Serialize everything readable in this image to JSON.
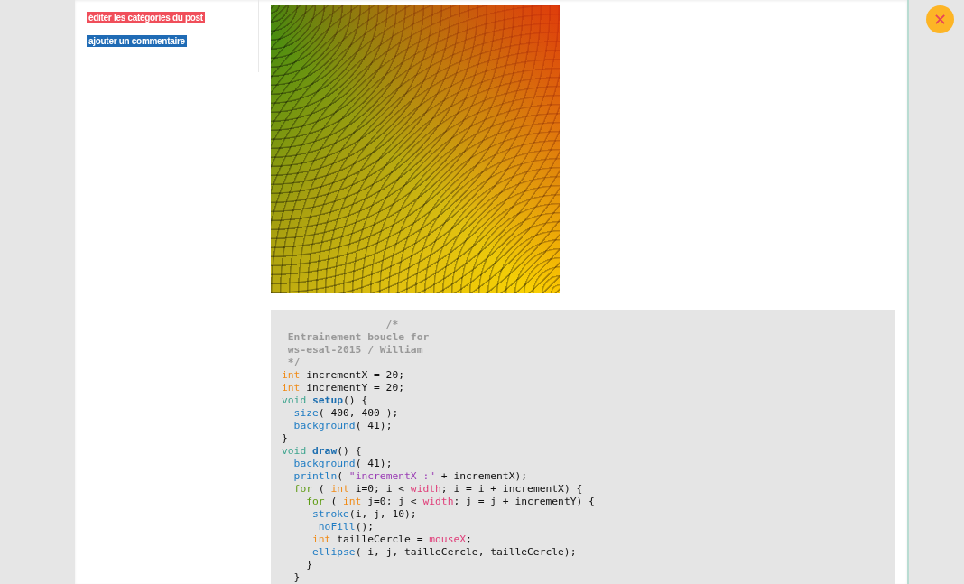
{
  "sidebar": {
    "links": [
      {
        "label": "éditer les catégories du post",
        "color": "#f04e5a"
      },
      {
        "label": "ajouter un commentaire",
        "color": "#1f6bb5"
      }
    ]
  },
  "close_button": {
    "label": "✕"
  },
  "code": {
    "lines": [
      [
        {
          "kind": "comment",
          "text": "                 /*"
        }
      ],
      [
        {
          "kind": "comment",
          "text": " Entrainement boucle for"
        }
      ],
      [
        {
          "kind": "comment",
          "text": " ws-esal-2015 / William"
        }
      ],
      [
        {
          "kind": "comment",
          "text": " */"
        }
      ],
      [
        {
          "kind": "type",
          "text": "int"
        },
        {
          "kind": "plain",
          "text": " incrementX = 20;"
        }
      ],
      [
        {
          "kind": "type",
          "text": "int"
        },
        {
          "kind": "plain",
          "text": " incrementY = 20;"
        }
      ],
      [
        {
          "kind": "declare",
          "text": "void"
        },
        {
          "kind": "function",
          "text": " setup"
        },
        {
          "kind": "plain",
          "text": "() {"
        }
      ],
      [
        {
          "kind": "builtin",
          "text": "  size"
        },
        {
          "kind": "plain",
          "text": "( 400, 400 );"
        }
      ],
      [
        {
          "kind": "builtin",
          "text": "  background"
        },
        {
          "kind": "plain",
          "text": "( 41);"
        }
      ],
      [
        {
          "kind": "plain",
          "text": "}"
        }
      ],
      [
        {
          "kind": "declare",
          "text": "void"
        },
        {
          "kind": "function",
          "text": " draw"
        },
        {
          "kind": "plain",
          "text": "() {"
        }
      ],
      [
        {
          "kind": "builtin",
          "text": "  background"
        },
        {
          "kind": "plain",
          "text": "( 41);"
        }
      ],
      [
        {
          "kind": "builtin",
          "text": "  println"
        },
        {
          "kind": "plain",
          "text": "( "
        },
        {
          "kind": "string",
          "text": "\"incrementX :\""
        },
        {
          "kind": "plain",
          "text": " + incrementX);"
        }
      ],
      [
        {
          "kind": "control",
          "text": "  for"
        },
        {
          "kind": "plain",
          "text": " ( "
        },
        {
          "kind": "type",
          "text": "int"
        },
        {
          "kind": "plain",
          "text": " i=0; i < "
        },
        {
          "kind": "constant",
          "text": "width"
        },
        {
          "kind": "plain",
          "text": "; i = i + incrementX) {"
        }
      ],
      [
        {
          "kind": "control",
          "text": "    for"
        },
        {
          "kind": "plain",
          "text": " ( "
        },
        {
          "kind": "type",
          "text": "int"
        },
        {
          "kind": "plain",
          "text": " j=0; j < "
        },
        {
          "kind": "constant",
          "text": "width"
        },
        {
          "kind": "plain",
          "text": "; j = j + incrementY) {"
        }
      ],
      [
        {
          "kind": "builtin",
          "text": "     stroke"
        },
        {
          "kind": "plain",
          "text": "(i, j, 10);"
        }
      ],
      [
        {
          "kind": "builtin",
          "text": "      noFill"
        },
        {
          "kind": "plain",
          "text": "();"
        }
      ],
      [
        {
          "kind": "type",
          "text": "     int"
        },
        {
          "kind": "plain",
          "text": " tailleCercle = "
        },
        {
          "kind": "constant",
          "text": "mouseX"
        },
        {
          "kind": "plain",
          "text": ";"
        }
      ],
      [
        {
          "kind": "builtin",
          "text": "     ellipse"
        },
        {
          "kind": "plain",
          "text": "( i, j, tailleCercle, tailleCercle);"
        }
      ],
      [
        {
          "kind": "plain",
          "text": "    }"
        }
      ],
      [
        {
          "kind": "plain",
          "text": "  }"
        }
      ]
    ]
  }
}
